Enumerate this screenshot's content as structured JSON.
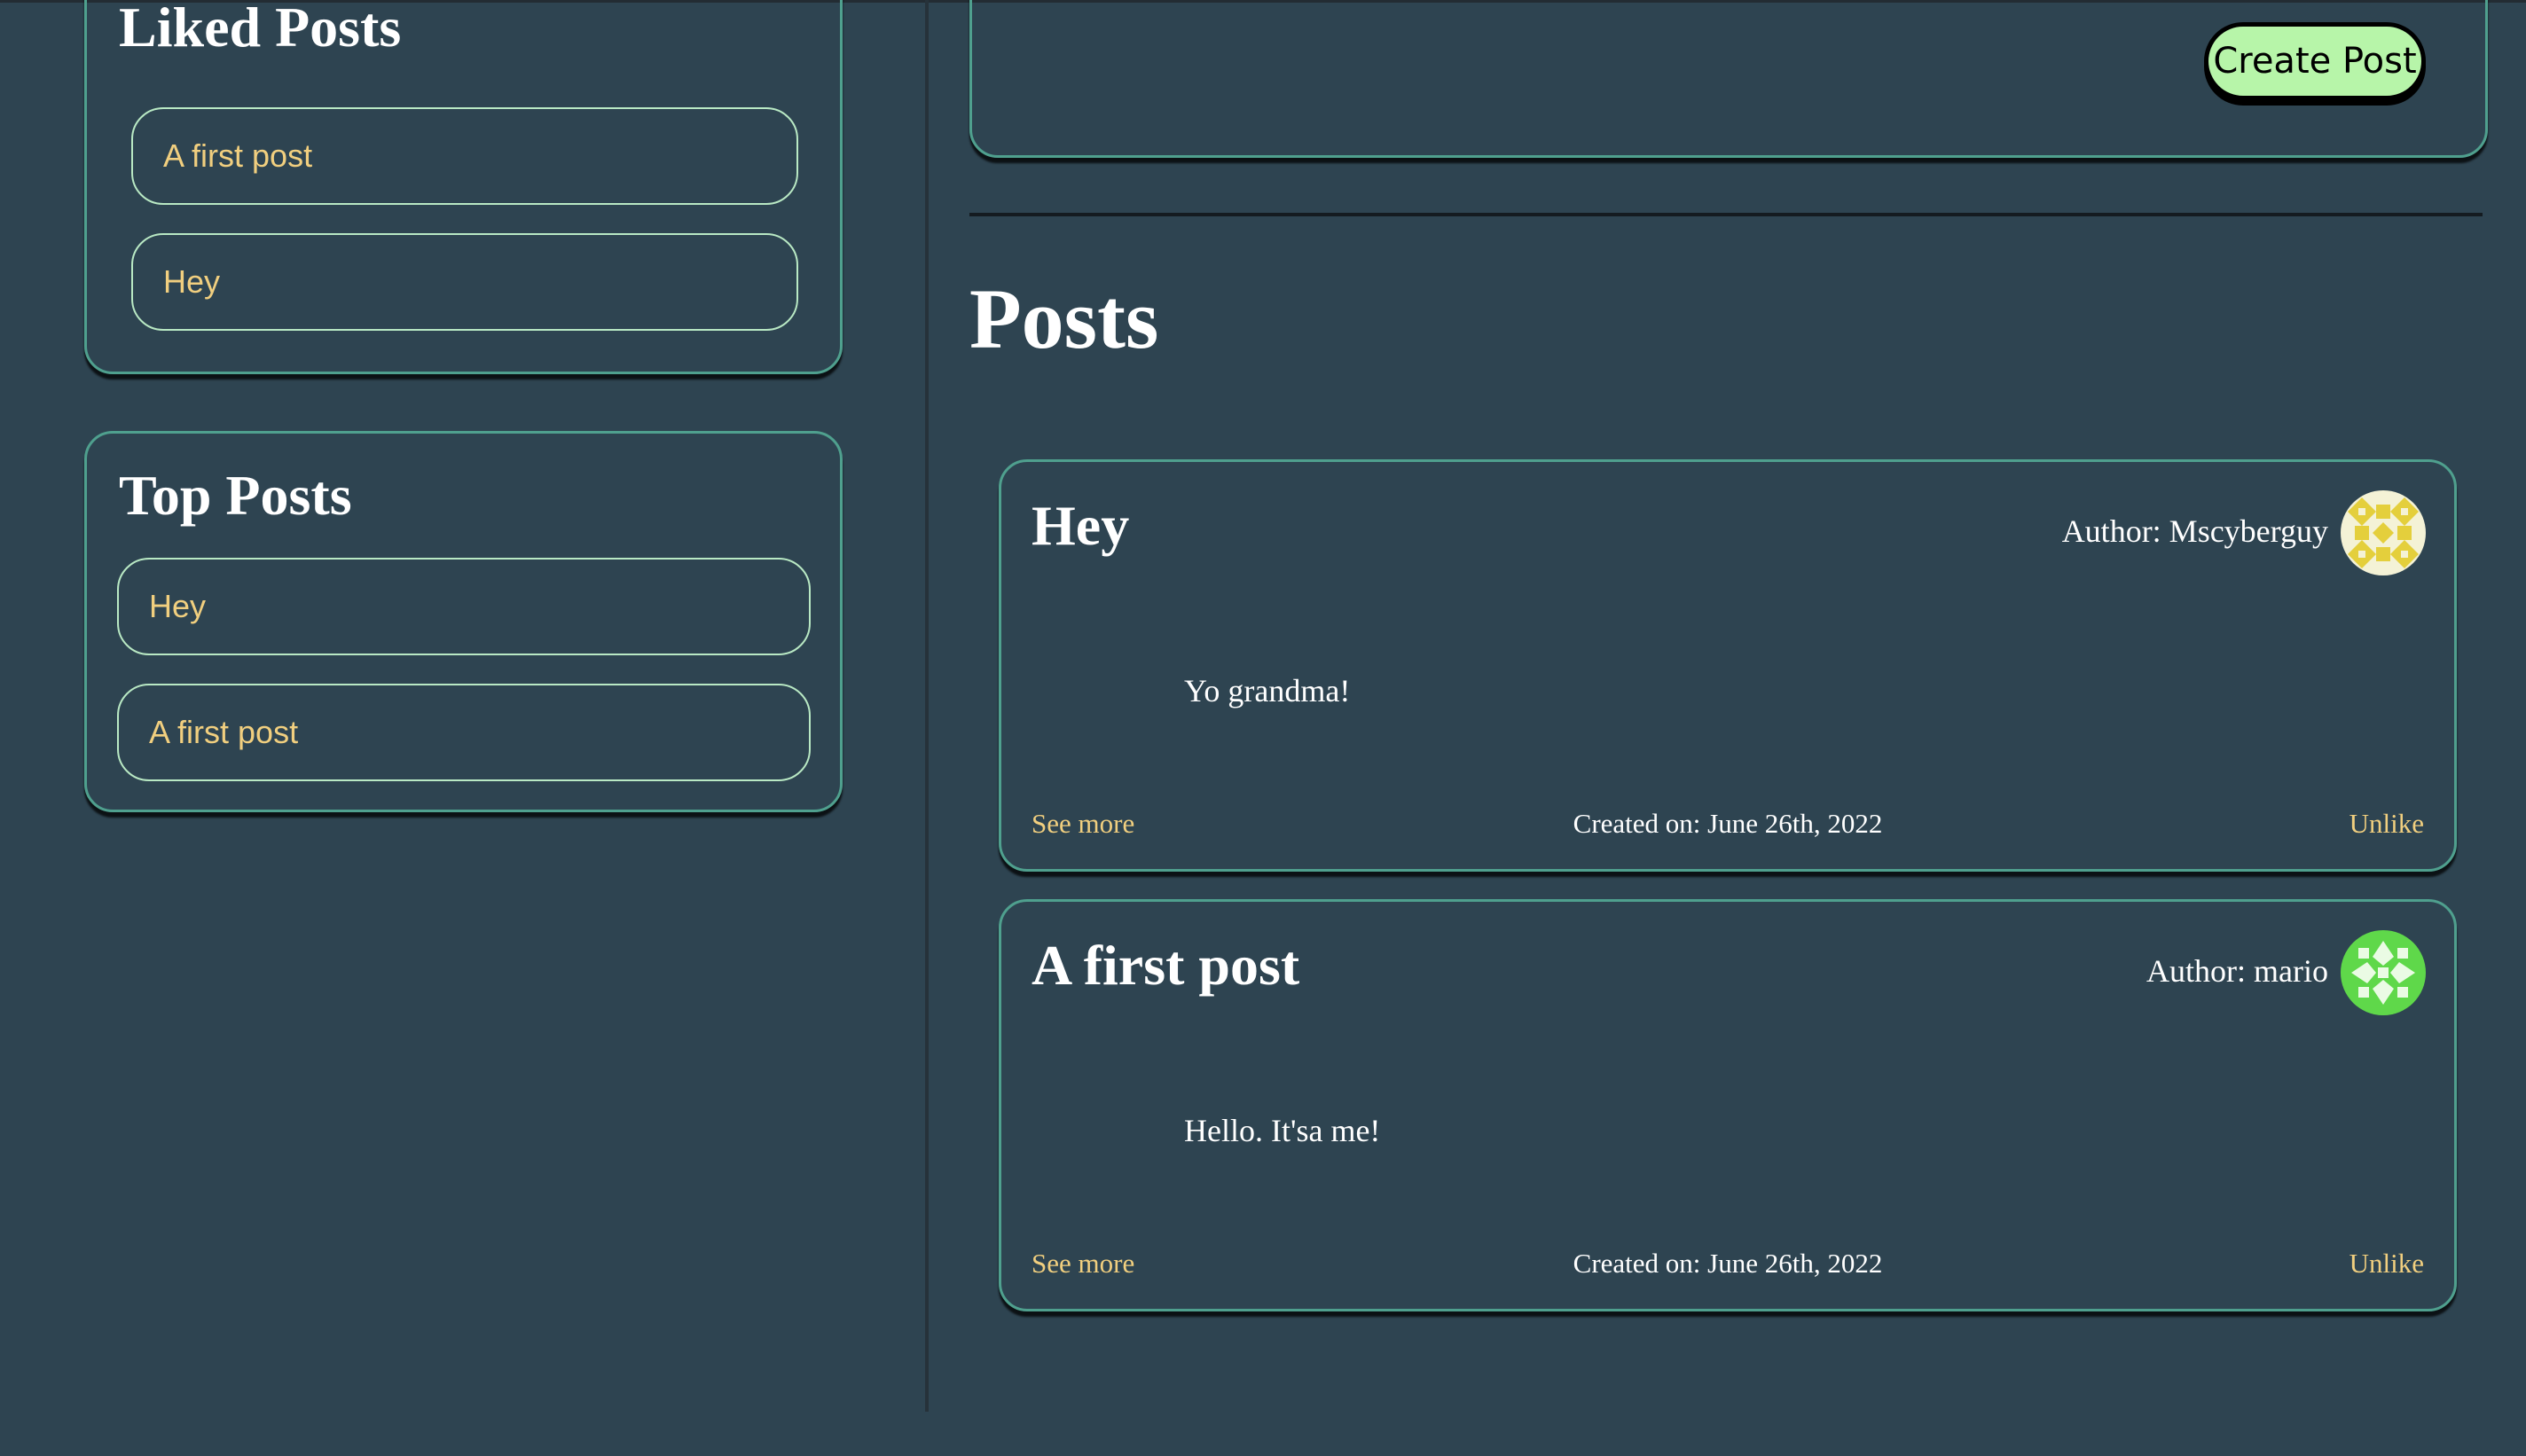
{
  "colors": {
    "background": "#2e4451",
    "panel_border": "#4fa08e",
    "link": "#f1cf7f",
    "pill_border": "#b9e9c4",
    "button": "#b7f5a9"
  },
  "sidebar": {
    "liked": {
      "title": "Liked Posts",
      "items": [
        {
          "label": "A first post"
        },
        {
          "label": "Hey"
        }
      ]
    },
    "top": {
      "title": "Top Posts",
      "items": [
        {
          "label": "Hey"
        },
        {
          "label": "A first post"
        }
      ]
    }
  },
  "composer": {
    "create_label": "Create Post"
  },
  "main": {
    "heading": "Posts",
    "posts": [
      {
        "title": "Hey",
        "author": "Author: Mscyberguy",
        "avatar_icon": "identicon-avatar-yellow",
        "body": "Yo grandma!",
        "see_more": "See more",
        "created": "Created on: June 26th, 2022",
        "like_action": "Unlike"
      },
      {
        "title": "A first post",
        "author": "Author: mario",
        "avatar_icon": "identicon-avatar-green",
        "body": "Hello. It'sa me!",
        "see_more": "See more",
        "created": "Created on: June 26th, 2022",
        "like_action": "Unlike"
      }
    ]
  }
}
